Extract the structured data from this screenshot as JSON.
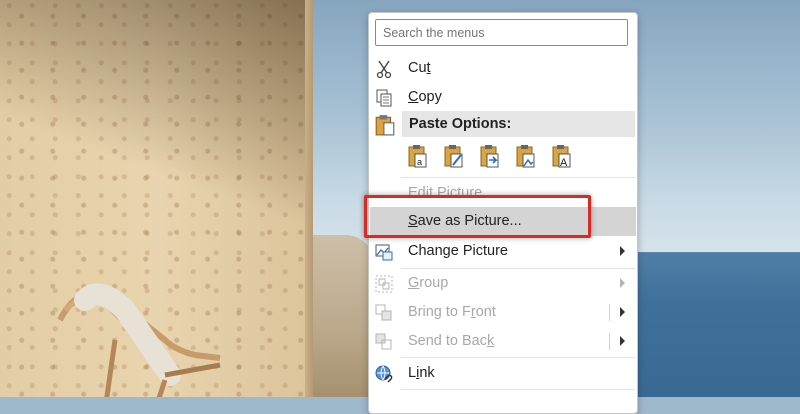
{
  "menu": {
    "search_placeholder": "Search the menus",
    "items": {
      "cut": {
        "pre": "Cu",
        "ul": "t",
        "post": ""
      },
      "copy": {
        "pre": "",
        "ul": "C",
        "post": "opy"
      },
      "paste_options": "Paste Options:",
      "edit_picture": "Edit Picture",
      "save_as_picture": {
        "pre": "",
        "ul": "S",
        "post": "ave as Picture..."
      },
      "change_picture": {
        "pre": "Chan",
        "ul": "g",
        "post": "e Picture"
      },
      "group": {
        "pre": "",
        "ul": "G",
        "post": "roup"
      },
      "bring_to_front": {
        "pre": "Bring to F",
        "ul": "r",
        "post": "ont"
      },
      "send_to_back": {
        "pre": "Send to Bac",
        "ul": "k",
        "post": ""
      },
      "link": {
        "pre": "L",
        "ul": "i",
        "post": "nk"
      }
    }
  },
  "colors": {
    "highlight_box": "#d62b27",
    "hover_bg": "#d4d4d4"
  },
  "icons": [
    "scissors-icon",
    "copy-icon",
    "clipboard-icon",
    "paste-keep-formatting-icon",
    "paste-merge-icon",
    "paste-link-icon",
    "paste-picture-icon",
    "paste-text-only-icon",
    "change-picture-icon",
    "group-icon",
    "bring-to-front-icon",
    "send-to-back-icon",
    "link-icon"
  ]
}
